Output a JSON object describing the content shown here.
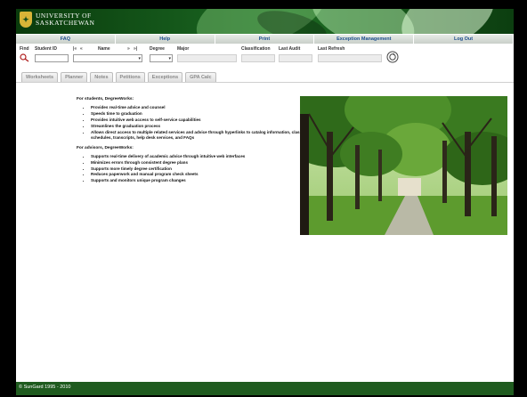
{
  "header": {
    "university_line1": "UNIVERSITY OF",
    "university_line2": "SASKATCHEWAN"
  },
  "nav": {
    "faq": "FAQ",
    "help": "Help",
    "print": "Print",
    "exception_management": "Exception Management",
    "logout": "Log Out"
  },
  "student_bar": {
    "find": "Find",
    "student_id": "Student ID",
    "pager_first": "|«",
    "pager_prev": "«",
    "pager_next": "»",
    "pager_last": "»|",
    "name": "Name",
    "degree": "Degree",
    "major": "Major",
    "classification": "Classification",
    "last_audit": "Last Audit",
    "last_refresh": "Last Refresh"
  },
  "tabs": [
    "Worksheets",
    "Planner",
    "Notes",
    "Petitions",
    "Exceptions",
    "GPA Calc"
  ],
  "content": {
    "students_heading": "For students, DegreeWorks:",
    "students_items": [
      "Provides real-time advice and counsel",
      "Speeds time to graduation",
      "Provides intuitive web access to self-service capabilities",
      "Streamlines the graduation process",
      "Allows direct access to multiple related services and advice through hyperlinks to catalog information, class schedules, transcripts, help desk services, and FAQs"
    ],
    "advisors_heading": "For advisors, DegreeWorks:",
    "advisors_items": [
      "Supports real-time delivery of academic advice through intuitive web interfaces",
      "Minimizes errors through consistent degree plans",
      "Supports more timely degree certification",
      "Reduces paperwork and manual program check sheets",
      "Supports and monitors unique program changes"
    ]
  },
  "footer": {
    "copyright": "© SunGard 1995 - 2010"
  },
  "colors": {
    "header_green": "#14561a",
    "nav_text": "#1b4d8c",
    "footer_green": "#1f5b1f"
  }
}
